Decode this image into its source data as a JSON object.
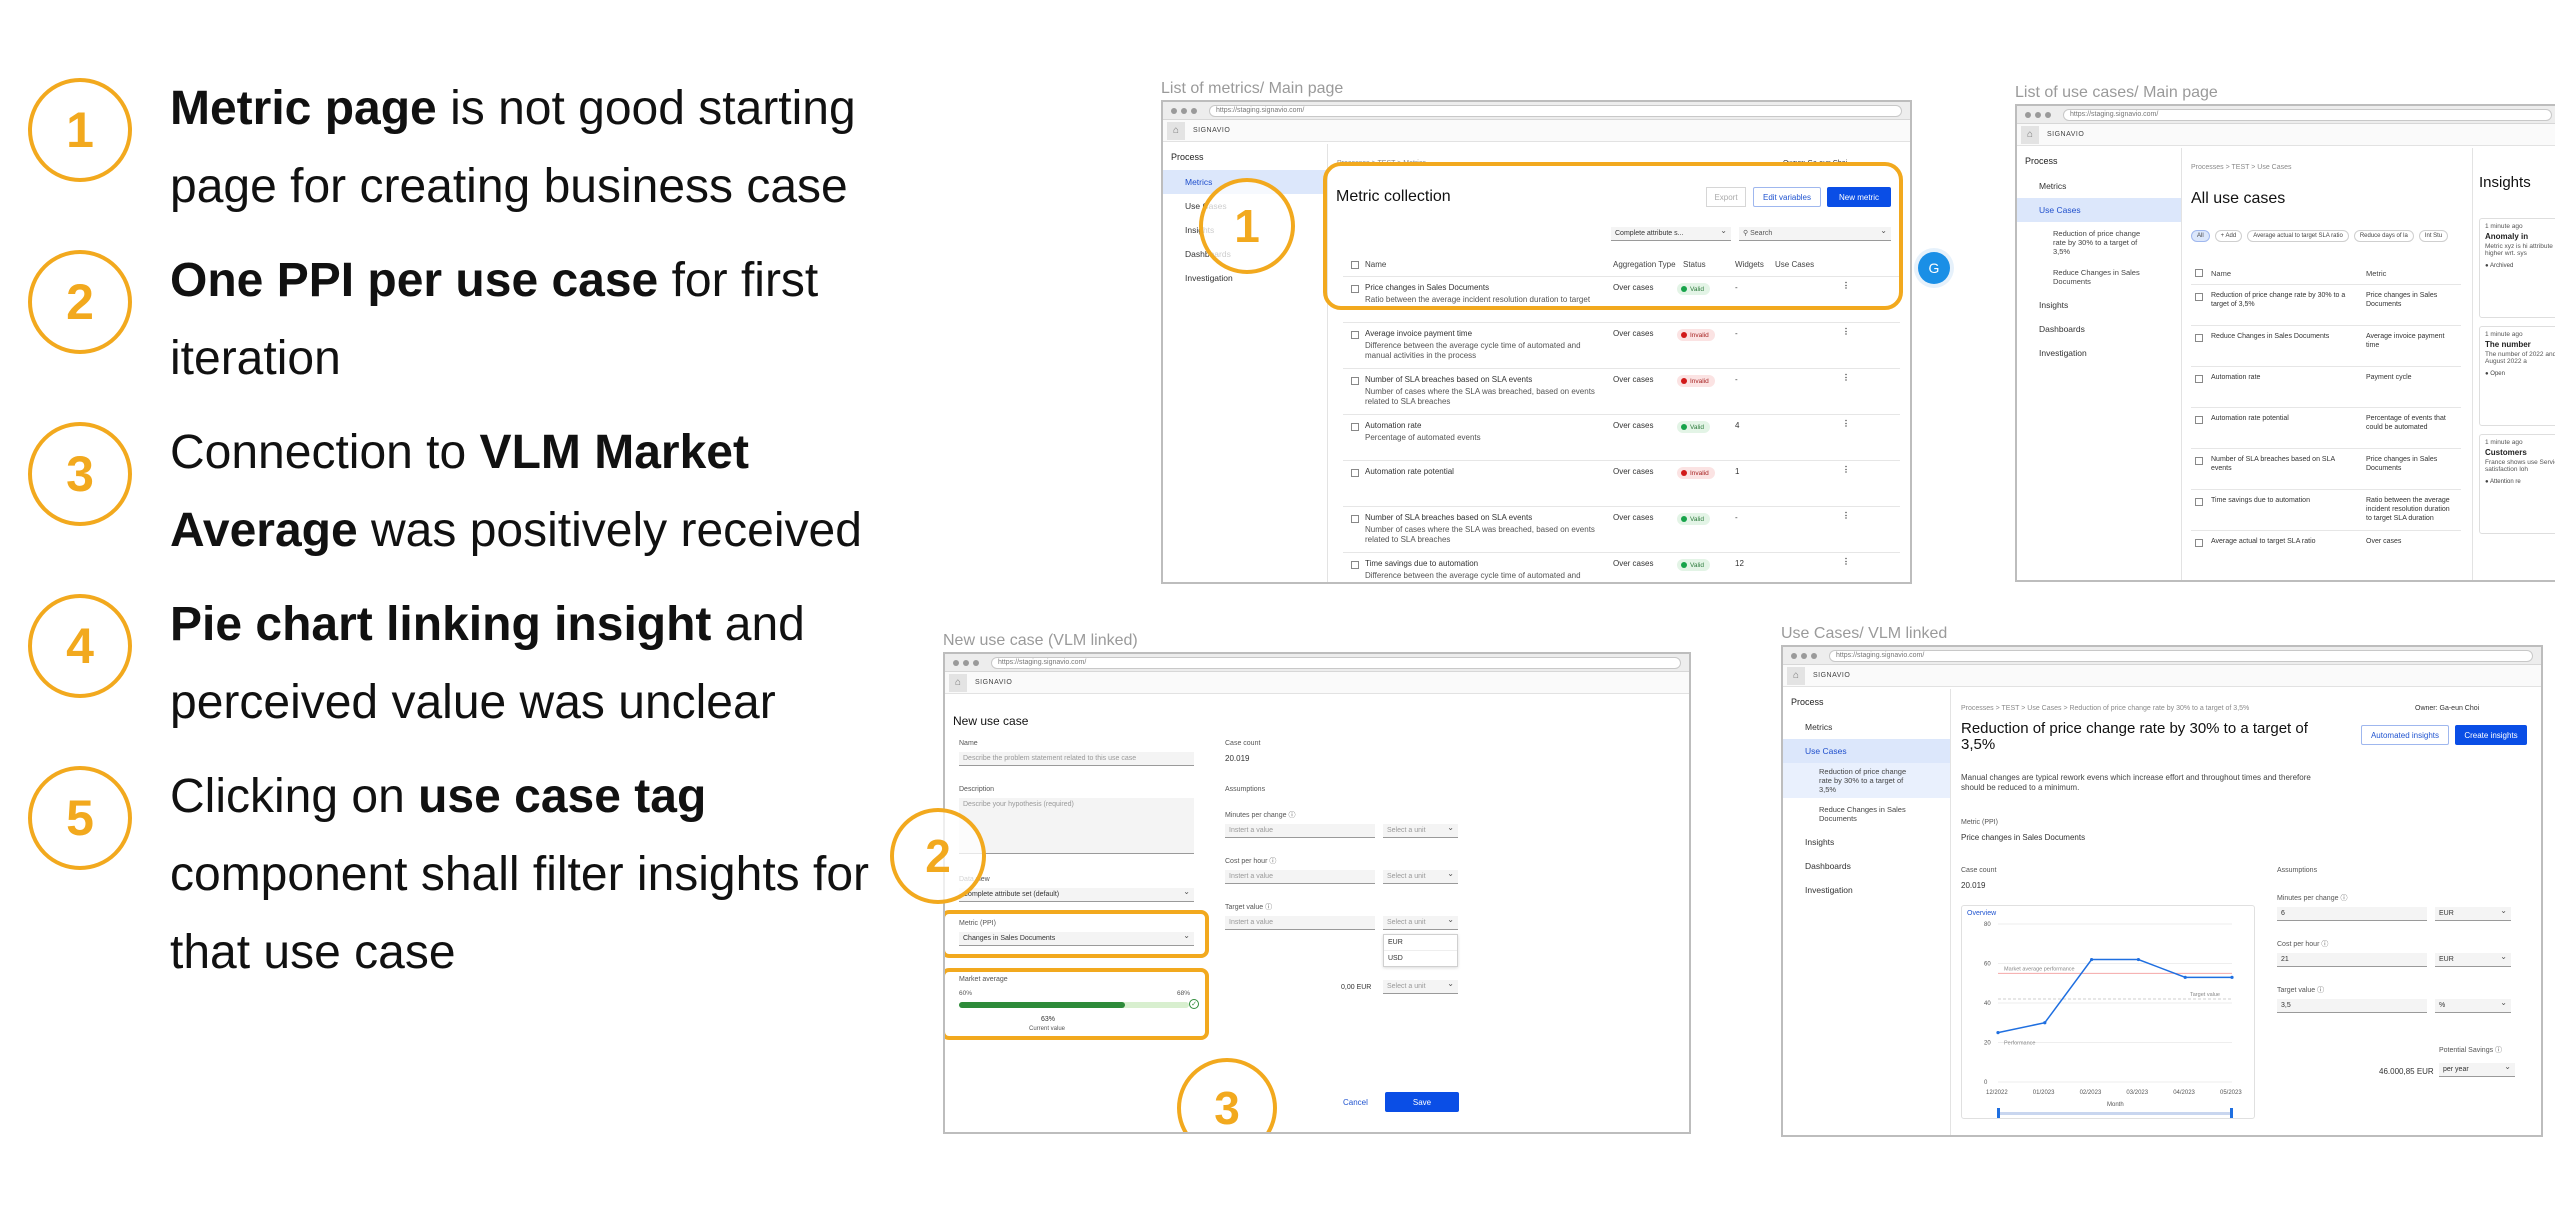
{
  "feedback": [
    {
      "num": "1",
      "pre": "",
      "bold1": "Metric page",
      "mid": " is not good starting page for creating business case",
      "bold2": "",
      "post": ""
    },
    {
      "num": "2",
      "pre": "",
      "bold1": "One PPI per use case",
      "mid": " for first iteration",
      "bold2": "",
      "post": ""
    },
    {
      "num": "3",
      "pre": "Connection to ",
      "bold1": "VLM Market Average",
      "mid": " was positively received",
      "bold2": "",
      "post": ""
    },
    {
      "num": "4",
      "pre": "",
      "bold1": "Pie chart linking insight",
      "mid": " and perceived value was unclear",
      "bold2": "",
      "post": ""
    },
    {
      "num": "5",
      "pre": "Clicking on ",
      "bold1": "use case tag",
      "mid": " component shall filter insights for that use case",
      "bold2": "",
      "post": ""
    }
  ],
  "captions": {
    "metrics": "List of metrics/ Main page",
    "usecases": "List of use cases/ Main page",
    "new_use_case": "New use case (VLM linked)",
    "vlm_linked": "Use Cases/ VLM linked"
  },
  "common": {
    "url": "https://staging.signavio.com/",
    "brand": "SIGNAVIO",
    "process": "Process",
    "nav": [
      "Metrics",
      "Use Cases",
      "Insights",
      "Dashboards",
      "Investigation"
    ]
  },
  "metrics_page": {
    "breadcrumb": "Processes > TEST > Metrics",
    "owner": "Owner: Ga-eun Choi",
    "title": "Metric collection",
    "export": "Export",
    "edit_variables": "Edit variables",
    "new_metric": "New metric",
    "filter": "Complete attribute s...",
    "search": "Search",
    "columns": [
      "Name",
      "Aggregation Type",
      "Status",
      "Widgets",
      "Use Cases"
    ],
    "rows": [
      {
        "name": "Price changes in Sales Documents",
        "desc": "Ratio between the average incident resolution duration to target",
        "agg": "Over cases",
        "status": "Valid",
        "ok": true,
        "widgets": "-"
      },
      {
        "name": "Average invoice payment time",
        "desc": "Difference between the average cycle time of automated and manual activities in the process",
        "agg": "Over cases",
        "status": "Invalid",
        "ok": false,
        "widgets": "-"
      },
      {
        "name": "Number of SLA breaches based on SLA events",
        "desc": "Number of cases where the SLA was breached, based on events related to SLA breaches",
        "agg": "Over cases",
        "status": "Invalid",
        "ok": false,
        "widgets": "-"
      },
      {
        "name": "Automation rate",
        "desc": "Percentage of automated events",
        "agg": "Over cases",
        "status": "Valid",
        "ok": true,
        "widgets": "4"
      },
      {
        "name": "Automation rate potential",
        "desc": "",
        "agg": "Over cases",
        "status": "Invalid",
        "ok": false,
        "widgets": "1"
      },
      {
        "name": "Number of SLA breaches based on SLA events",
        "desc": "Number of cases where the SLA was breached, based on events related to SLA breaches",
        "agg": "Over cases",
        "status": "Valid",
        "ok": true,
        "widgets": "-"
      },
      {
        "name": "Time savings due to automation",
        "desc": "Difference between the average cycle time of automated and",
        "agg": "Over cases",
        "status": "Valid",
        "ok": true,
        "widgets": "12"
      }
    ],
    "avatar": "G"
  },
  "usecases_page": {
    "breadcrumb": "Processes > TEST > Use Cases",
    "title": "All use cases",
    "sub_items": [
      "Reduction of price change rate by 30% to a target of 3,5%",
      "Reduce Changes in Sales Documents"
    ],
    "chips": [
      "All",
      "+ Add",
      "Average actual to target SLA ratio",
      "Reduce days of la",
      "Int Stu"
    ],
    "columns": [
      "Name",
      "Metric"
    ],
    "rows": [
      {
        "name": "Reduction of price change rate by 30% to a target of 3,5%",
        "metric": "Price changes in Sales Documents"
      },
      {
        "name": "Reduce Changes in Sales Documents",
        "metric": "Average invoice payment time"
      },
      {
        "name": "Automation rate",
        "metric": "Payment cycle"
      },
      {
        "name": "Automation rate potential",
        "metric": "Percentage of events that could be automated"
      },
      {
        "name": "Number of SLA breaches based on SLA events",
        "metric": "Price changes in Sales Documents"
      },
      {
        "name": "Time savings due to automation",
        "metric": "Ratio between the average incident resolution duration to target SLA duration"
      },
      {
        "name": "Average actual to target SLA ratio",
        "metric": "Over cases"
      }
    ],
    "insights_title": "Insights",
    "insights": [
      {
        "time": "1 minute ago",
        "title": "Anomaly in",
        "body": "Metric xyz is hi attribute is X.M higher wrt. sys",
        "tag": "Archived"
      },
      {
        "time": "1 minute ago",
        "title": "The number",
        "body": "The number of 2022 andThe n August 2022 a",
        "tag": "Open"
      },
      {
        "time": "1 minute ago",
        "title": "Customers",
        "body": "France shows use Service Po satisfaction loh",
        "tag": "Attention re"
      }
    ]
  },
  "new_use_case": {
    "title": "New use case",
    "name_label": "Name",
    "name_placeholder": "Describe the problem statement related to this use case",
    "desc_label": "Description",
    "desc_placeholder": "Describe your hypothesis (required)",
    "data_view_label": "Data view",
    "data_view_value": "Complete attribute set (default)",
    "metric_label": "Metric (PPI)",
    "metric_value": "Changes in Sales Documents",
    "market_label": "Market average",
    "market_min": "60%",
    "market_max": "68%",
    "market_current": "63%",
    "market_current_label": "Current value",
    "market_fill": 0.72,
    "case_count_label": "Case count",
    "case_count": "20.019",
    "assumptions": "Assumptions",
    "minutes_label": "Minutes per change",
    "cost_label": "Cost per hour",
    "target_label": "Target value",
    "insert_value": "Instert a value",
    "select_unit": "Select a unit",
    "unit_options": [
      "EUR",
      "USD"
    ],
    "total": "0,00 EUR",
    "cancel": "Cancel",
    "save": "Save"
  },
  "vlm_page": {
    "breadcrumb": "Processes > TEST > Use Cases > Reduction of price change rate by 30% to a target of 3,5%",
    "owner": "Owner: Ga-eun Choi",
    "sub_items": [
      "Reduction of price change rate by 30% to a target of 3,5%",
      "Reduce Changes in Sales Documents"
    ],
    "title": "Reduction of price change rate by 30% to a target of 3,5%",
    "subtitle": "Manual changes are typical rework evens which increase effort and throughout times and therefore should be reduced to a minimum.",
    "automated_insights": "Automated insights",
    "create_insights": "Create insights",
    "metric_label": "Metric (PPI)",
    "metric_value": "Price changes in Sales Documents",
    "case_count_label": "Case count",
    "case_count": "20.019",
    "overview": "Overview",
    "assumptions": "Assumptions",
    "minutes_label": "Minutes per change",
    "minutes_value": "6",
    "cost_label": "Cost per hour",
    "cost_value": "21",
    "target_label": "Target value",
    "target_value": "3,5",
    "unit_eur": "EUR",
    "unit_pct": "%",
    "savings_label": "Potential Savings",
    "savings_value": "46.000,85 EUR",
    "savings_period": "per year"
  },
  "chart_data": {
    "type": "line",
    "x": [
      "12/2022",
      "01/2023",
      "02/2023",
      "03/2023",
      "04/2023",
      "05/2023"
    ],
    "series": [
      {
        "name": "",
        "values": [
          25,
          30,
          62,
          62,
          53,
          53
        ]
      }
    ],
    "reference_lines": [
      {
        "label": "Market average performance",
        "value": 55
      },
      {
        "label": "Target value",
        "value": 42
      }
    ],
    "annotation": "Performance",
    "xlabel": "Month",
    "ylabel": "",
    "yticks": [
      0,
      20,
      40,
      60,
      80
    ],
    "ylim": [
      0,
      80
    ]
  },
  "colors": {
    "accent": "#f2a91e",
    "primary": "#0a4ee6",
    "valid": "#17a34a",
    "invalid": "#d11a1a"
  }
}
